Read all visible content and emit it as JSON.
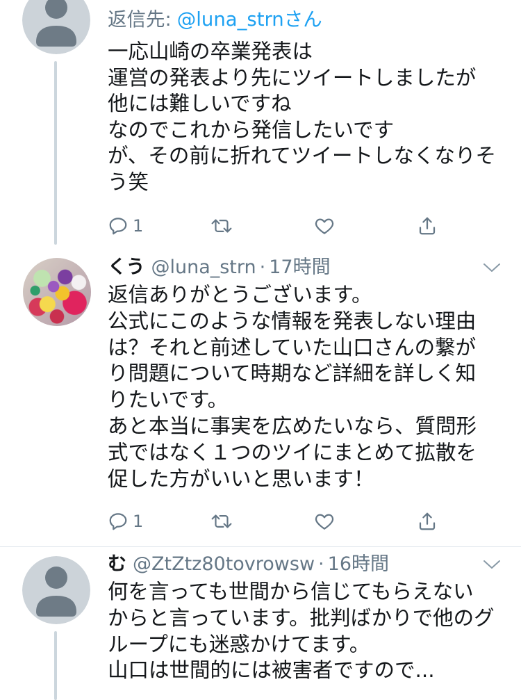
{
  "colors": {
    "text": "#14171a",
    "secondary_text": "#657786",
    "link": "#1da1f2",
    "thread_line": "#ccd6dd",
    "divider": "#e1e8ed",
    "default_avatar_bg": "#ccd3d9",
    "default_avatar_fg": "#6e7b86"
  },
  "icons": {
    "default_avatar": "default-avatar-icon",
    "reply": "reply-icon",
    "retweet": "retweet-icon",
    "like": "heart-icon",
    "share": "share-icon",
    "menu": "chevron-down-icon"
  },
  "tweets": [
    {
      "reply_to": {
        "label": "返信先:",
        "handle": "@luna_strnさん"
      },
      "body": [
        "一応山崎の卒業発表は",
        "運営の発表より先にツイートしましたが",
        "他には難しいですね",
        "なのでこれから発信したいです",
        "が、その前に折れてツイートしなくなりそ",
        "う笑"
      ],
      "actions": {
        "reply_count": "1"
      }
    },
    {
      "name": "くう",
      "handle": "@luna_strn",
      "separator": "·",
      "time": "17時間",
      "body": [
        "返信ありがとうございます。",
        "公式にこのような情報を発表しない理由",
        "は？それと前述していた山口さんの繋が",
        "り問題について時期など詳細を詳しく知",
        "りたいです。",
        "あと本当に事実を広めたいなら、質問形",
        "式ではなく１つのツイにまとめて拡散を",
        "促した方がいいと思います！"
      ],
      "actions": {
        "reply_count": "1"
      }
    },
    {
      "name": "む",
      "handle": "@ZtZtz80tovrowsw",
      "separator": "·",
      "time": "16時間",
      "body": [
        "何を言っても世間から信じてもらえない",
        "からと言っています。批判ばかりで他のグ",
        "ループにも迷惑かけてます。",
        "山口は世間的には被害者ですので..."
      ]
    }
  ]
}
